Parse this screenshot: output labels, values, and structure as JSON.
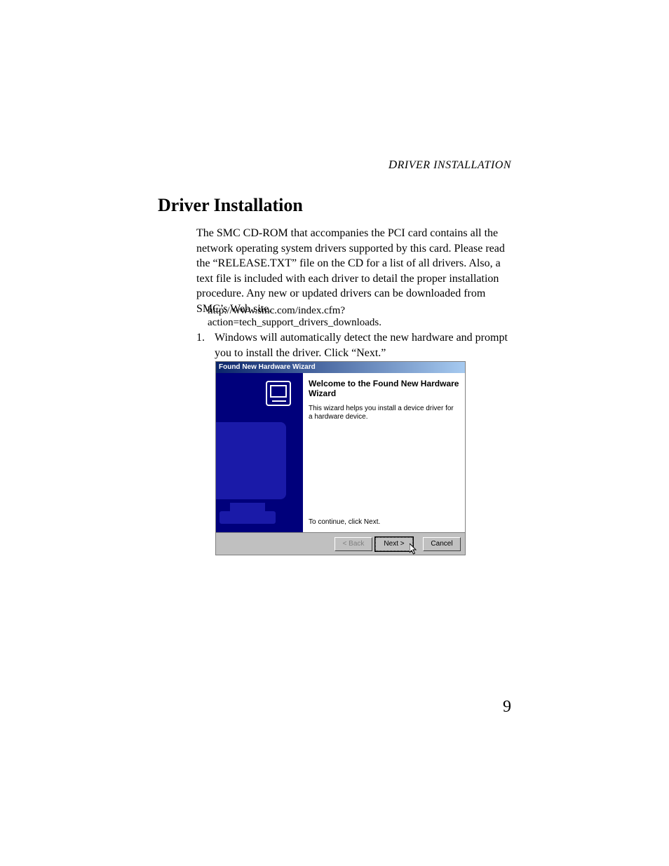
{
  "header": {
    "running": "Driver Installation"
  },
  "title": "Driver Installation",
  "paragraph": "The SMC CD-ROM that accompanies the PCI card contains all the network operating system drivers supported by this card. Please read the “RELEASE.TXT” file on the CD for a list of all drivers. Also, a text file is included with each driver to detail the proper installation procedure. Any new or updated drivers can be downloaded from SMC’s Web site.",
  "url": "http://www.smc.com/index.cfm?action=tech_support_drivers_downloads.",
  "step": {
    "num": "1.",
    "text": "Windows will automatically detect the new hardware and prompt you to install the driver. Click “Next.”"
  },
  "wizard": {
    "title": "Found New Hardware Wizard",
    "welcome": "Welcome to the Found New Hardware Wizard",
    "desc": "This wizard helps you install a device driver for a hardware device.",
    "continue": "To continue, click Next.",
    "buttons": {
      "back": "< Back",
      "next": "Next >",
      "cancel": "Cancel"
    }
  },
  "page_number": "9"
}
